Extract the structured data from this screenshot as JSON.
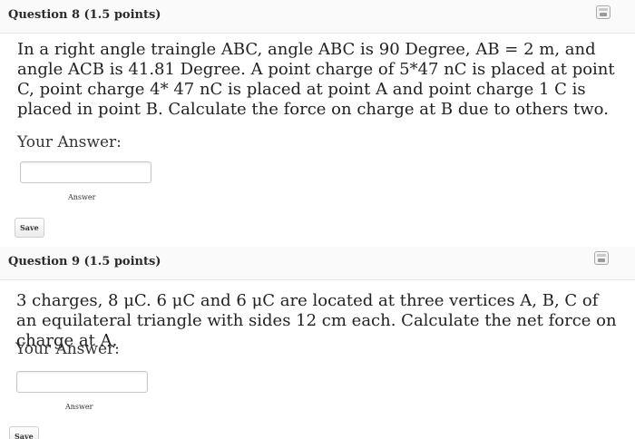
{
  "questions": [
    {
      "title": "Question 8 (1.5 points)",
      "text": "In a right angle traingle ABC, angle ABC is 90 Degree, AB = 2 m, and angle ACB is 41.81 Degree. A point charge of 5*47 nC is placed at point C, point charge 4* 47 nC is placed at point A and point charge 1 C is placed in point B. Calculate the force on charge at B due to others two.",
      "your_answer_label": "Your Answer:",
      "answer_value": "",
      "answer_caption": "Answer",
      "save_label": "Save",
      "flag_icon": "flag-icon"
    },
    {
      "title": "Question 9 (1.5 points)",
      "text": "3 charges, 8 μC. 6 μC and 6 μC are located at three vertices A, B, C of an equilateral triangle with sides 12 cm each. Calculate the net force on charge at A.",
      "your_answer_label": "Your Answer:",
      "answer_value": "",
      "answer_caption": "Answer",
      "save_label": "Save",
      "flag_icon": "flag-icon"
    }
  ]
}
